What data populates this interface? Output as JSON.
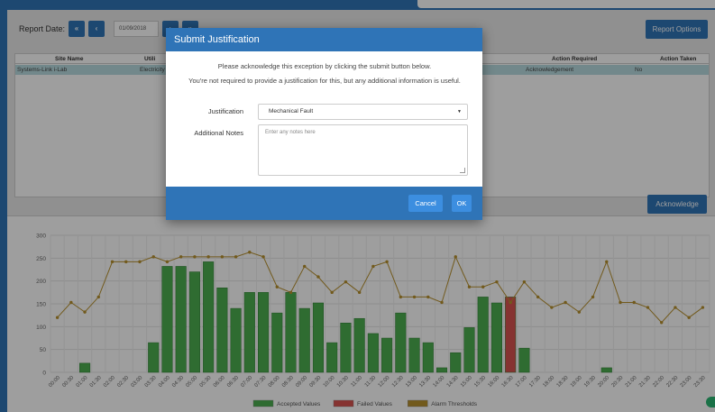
{
  "toolbar": {
    "report_date_label": "Report Date:",
    "first_btn": "«",
    "prev_btn": "‹",
    "date_value": "01/09/2018",
    "next_btn": "›",
    "last_btn": "»",
    "report_options_label": "Report Options"
  },
  "table": {
    "headers": [
      "Site Name",
      "Utili",
      "Action Required",
      "Action Taken"
    ],
    "row": [
      "Systems-Link i-Lab",
      "Electricity",
      "Acknowledgement",
      "No"
    ]
  },
  "acknowledge_label": "Acknowledge",
  "modal": {
    "title": "Submit Justification",
    "message_1": "Please acknowledge this exception by clicking the submit button below.",
    "message_2": "You're not required to provide a justification for this, but any additional information is useful.",
    "justification_label": "Justification",
    "justification_value": "Mechanical Fault",
    "notes_label": "Additional Notes",
    "notes_placeholder": "Enter any notes here",
    "cancel_label": "Cancel",
    "ok_label": "OK"
  },
  "colors": {
    "primary": "#2f74b7",
    "accepted": "#4caf50",
    "failed": "#d9534f",
    "threshold": "#b8912e"
  },
  "icons": {
    "first": "double-chevron-left-icon",
    "prev": "chevron-left-icon",
    "next": "chevron-right-icon",
    "last": "double-chevron-right-icon",
    "caret": "caret-down-icon"
  },
  "chart_data": {
    "type": "bar",
    "categories": [
      "00:00",
      "00:30",
      "01:00",
      "01:30",
      "02:00",
      "02:30",
      "03:00",
      "03:30",
      "04:00",
      "04:30",
      "05:00",
      "05:30",
      "06:00",
      "06:30",
      "07:00",
      "07:30",
      "08:00",
      "08:30",
      "09:00",
      "09:30",
      "10:00",
      "10:30",
      "11:00",
      "11:30",
      "12:00",
      "12:30",
      "13:00",
      "13:30",
      "14:00",
      "14:30",
      "15:00",
      "15:30",
      "16:00",
      "16:30",
      "17:00",
      "17:30",
      "18:00",
      "18:30",
      "19:00",
      "19:30",
      "20:00",
      "20:30",
      "21:00",
      "21:30",
      "22:00",
      "22:30",
      "23:00",
      "23:30"
    ],
    "series": [
      {
        "name": "Accepted Values",
        "type": "bar",
        "color": "#4caf50",
        "values": [
          0,
          0,
          20,
          0,
          0,
          0,
          0,
          65,
          232,
          232,
          220,
          242,
          185,
          140,
          175,
          175,
          130,
          175,
          140,
          152,
          65,
          108,
          118,
          85,
          75,
          130,
          75,
          65,
          10,
          43,
          98,
          165,
          152,
          0,
          53,
          0,
          0,
          0,
          0,
          0,
          10,
          0,
          0,
          0,
          0,
          0,
          0,
          0
        ]
      },
      {
        "name": "Failed Values",
        "type": "bar",
        "color": "#d9534f",
        "values": [
          0,
          0,
          0,
          0,
          0,
          0,
          0,
          0,
          0,
          0,
          0,
          0,
          0,
          0,
          0,
          0,
          0,
          0,
          0,
          0,
          0,
          0,
          0,
          0,
          0,
          0,
          0,
          0,
          0,
          0,
          0,
          0,
          0,
          165,
          0,
          0,
          0,
          0,
          0,
          0,
          0,
          0,
          0,
          0,
          0,
          0,
          0,
          0
        ]
      },
      {
        "name": "Alarm Thresholds",
        "type": "line",
        "color": "#b8912e",
        "values": [
          120,
          153,
          132,
          165,
          242,
          242,
          242,
          253,
          242,
          253,
          253,
          253,
          253,
          253,
          263,
          253,
          187,
          175,
          232,
          209,
          175,
          198,
          175,
          232,
          242,
          165,
          165,
          165,
          153,
          253,
          187,
          187,
          198,
          153,
          198,
          165,
          142,
          153,
          132,
          165,
          242,
          153,
          153,
          142,
          109,
          142,
          120,
          142
        ]
      }
    ],
    "ylim": [
      0,
      300
    ],
    "yticks": [
      0,
      50,
      100,
      150,
      200,
      250,
      300
    ],
    "grid": true,
    "legend": "bottom"
  }
}
